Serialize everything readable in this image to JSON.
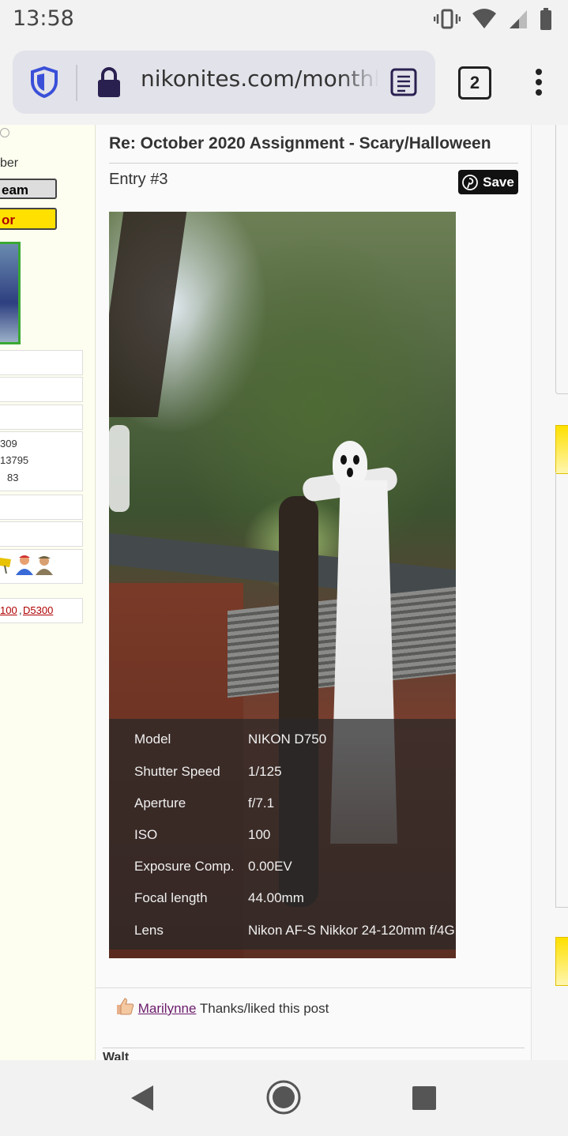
{
  "status": {
    "time": "13:58"
  },
  "browser": {
    "url": "nikonites.com/monthl",
    "tab_count": "2"
  },
  "sidebar": {
    "label_ber": "ber",
    "btn_team": "eam",
    "btn_or": "or",
    "stats": [
      "309",
      "13795",
      "83"
    ],
    "cameras": [
      "100",
      "D5300"
    ]
  },
  "post": {
    "title": "Re: October 2020 Assignment - Scary/Halloween",
    "entry": "Entry #3",
    "save_label": "Save",
    "exif": [
      {
        "label": "Model",
        "value": "NIKON D750"
      },
      {
        "label": "Shutter Speed",
        "value": "1/125"
      },
      {
        "label": "Aperture",
        "value": "f/7.1"
      },
      {
        "label": "ISO",
        "value": "100"
      },
      {
        "label": "Exposure Comp.",
        "value": "0.00EV"
      },
      {
        "label": "Focal length",
        "value": "44.00mm"
      },
      {
        "label": "Lens",
        "value": "Nikon AF-S Nikkor 24-120mm f/4G"
      }
    ],
    "liked_user": "Marilynne",
    "liked_text": " Thanks/liked this post",
    "next_author": "Walt"
  },
  "colors": {
    "accent_yellow": "#ffe000",
    "link_red": "#b00000",
    "shield_blue": "#3a4fd8"
  }
}
